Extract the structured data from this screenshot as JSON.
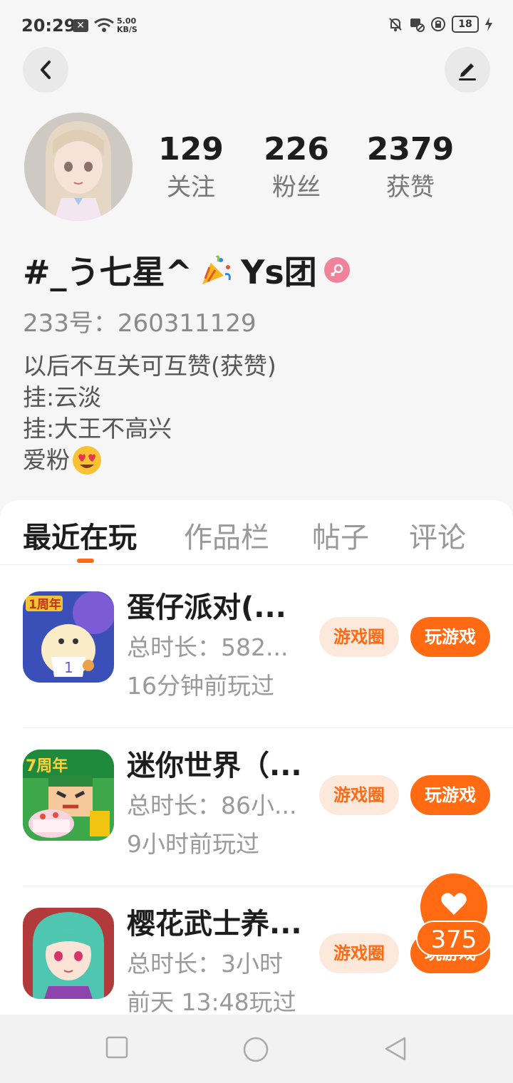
{
  "status_bar": {
    "time": "20:29",
    "speed_value": "5.00",
    "speed_unit": "KB/S",
    "battery": "18"
  },
  "profile": {
    "stats": [
      {
        "value": "129",
        "label": "关注"
      },
      {
        "value": "226",
        "label": "粉丝"
      },
      {
        "value": "2379",
        "label": "获赞"
      }
    ],
    "username_part1": "#_う七星^",
    "username_part2": "Ys团",
    "id_line": "233号：260311129",
    "bio_lines": [
      "以后不互关可互赞(获赞)",
      "挂:云淡",
      "挂:大王不高兴",
      "爱粉"
    ]
  },
  "tabs": [
    "最近在玩",
    "作品栏",
    "帖子",
    "评论"
  ],
  "games": [
    {
      "title": "蛋仔派对(...",
      "total_time": "总时长：582...",
      "last_played": "16分钟前玩过",
      "circle_label": "游戏圈",
      "play_label": "玩游戏"
    },
    {
      "title": "迷你世界（...",
      "total_time": "总时长：86小...",
      "last_played": "9小时前玩过",
      "circle_label": "游戏圈",
      "play_label": "玩游戏"
    },
    {
      "title": "樱花武士养...",
      "total_time": "总时长：3小时",
      "last_played": "前天 13:48玩过",
      "circle_label": "游戏圈",
      "play_label": "玩游戏"
    }
  ],
  "like_widget": {
    "count": "375"
  },
  "colors": {
    "accent": "#ff6a13",
    "accent_light": "#fde8dc",
    "gender_female": "#f0829c"
  }
}
